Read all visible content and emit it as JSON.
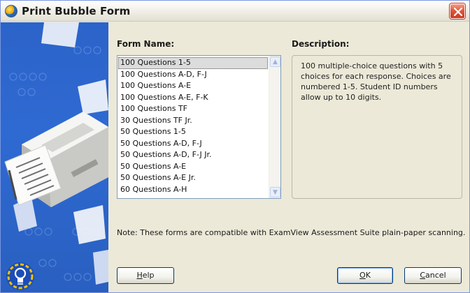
{
  "window": {
    "title": "Print Bubble Form"
  },
  "form_name": {
    "label": "Form Name:",
    "items": [
      "100 Questions 1-5",
      "100 Questions A-D, F-J",
      "100 Questions A-E",
      "100 Questions A-E, F-K",
      "100 Questions TF",
      "30 Questions TF Jr.",
      "50 Questions 1-5",
      "50 Questions A-D, F-J",
      "50 Questions A-D, F-J Jr.",
      "50 Questions A-E",
      "50 Questions A-E Jr.",
      "60 Questions A-H"
    ],
    "selected": "100 Questions 1-5"
  },
  "description": {
    "label": "Description:",
    "text": "100 multiple-choice questions with 5 choices for each response. Choices are numbered 1-5. Student ID numbers allow up to 10 digits."
  },
  "note": "Note: These forms are compatible with ExamView Assessment Suite plain-paper scanning.",
  "buttons": {
    "help": {
      "mnemonic": "H",
      "rest": "elp"
    },
    "ok": {
      "mnemonic": "O",
      "rest": "K"
    },
    "cancel": {
      "mnemonic": "C",
      "rest": "ancel"
    }
  },
  "icons": {
    "app": "app-globe-icon",
    "close": "close-icon",
    "hint": "lightbulb-icon"
  },
  "colors": {
    "title_close": "#e0583a",
    "side_panel": "#2f6ad2",
    "button_border": "#003c74",
    "list_border": "#7f9db9"
  }
}
